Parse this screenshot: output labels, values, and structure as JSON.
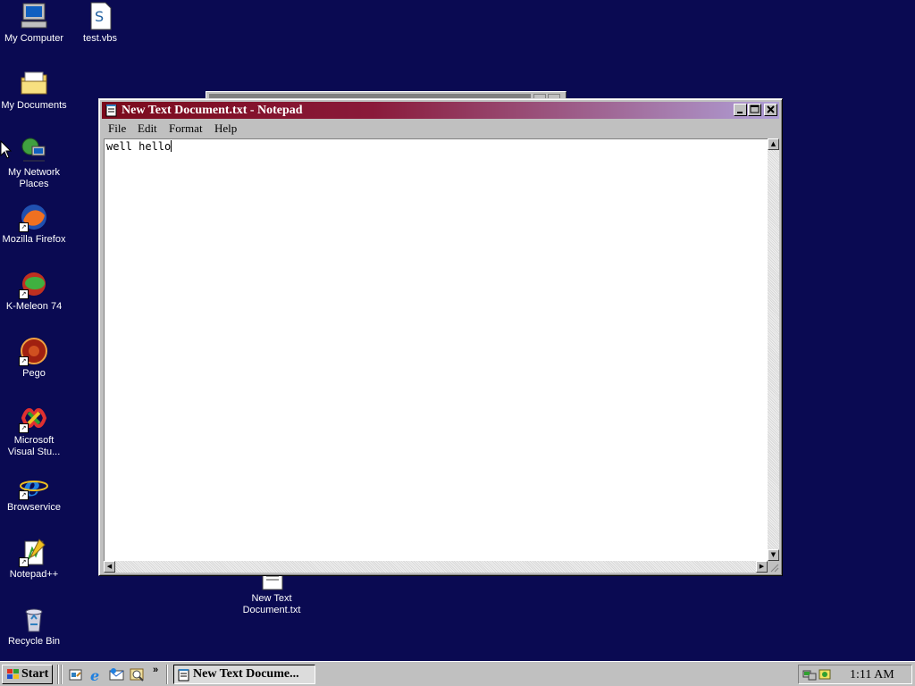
{
  "desktop": {
    "icons": [
      {
        "label": "My Computer",
        "icon": "computer-icon"
      },
      {
        "label": "test.vbs",
        "icon": "script-file-icon"
      },
      {
        "label": "My Documents",
        "icon": "folder-icon"
      },
      {
        "label": "My Network Places",
        "icon": "network-icon"
      },
      {
        "label": "Mozilla Firefox",
        "icon": "firefox-icon"
      },
      {
        "label": "K-Meleon 74",
        "icon": "kmeleon-icon"
      },
      {
        "label": "Pego",
        "icon": "pego-icon"
      },
      {
        "label": "Microsoft Visual Stu...",
        "icon": "visual-studio-icon"
      },
      {
        "label": "Browservice",
        "icon": "internet-explorer-icon"
      },
      {
        "label": "Notepad++",
        "icon": "notepadpp-icon"
      },
      {
        "label": "Recycle Bin",
        "icon": "recycle-bin-icon"
      },
      {
        "label": "New Text Document.txt",
        "icon": "text-file-icon"
      }
    ]
  },
  "notepad": {
    "title": "New Text Document.txt - Notepad",
    "menu": [
      "File",
      "Edit",
      "Format",
      "Help"
    ],
    "content": "well hello",
    "colors": {
      "title_start": "#7b0a1c",
      "title_end": "#b0a0d8"
    }
  },
  "taskbar": {
    "start_label": "Start",
    "quick_launch": [
      "show-desktop-icon",
      "internet-explorer-icon",
      "outlook-icon",
      "search-icon"
    ],
    "more": "»",
    "task_label": "New Text Docume...",
    "clock": "1:11 AM"
  },
  "colors": {
    "desktop": "#0a0a52",
    "chrome": "#c0c0c0"
  }
}
